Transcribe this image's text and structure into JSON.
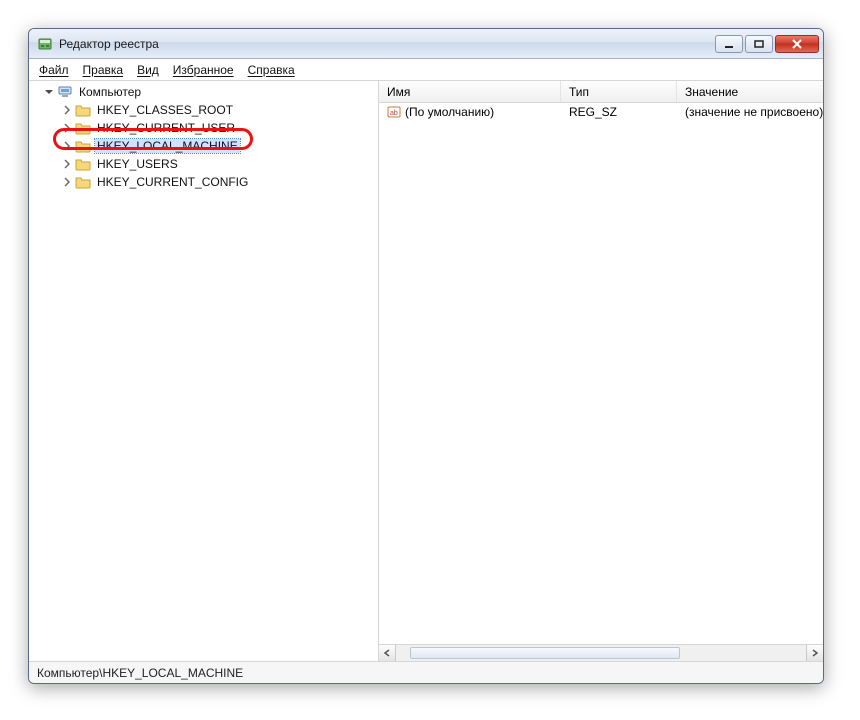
{
  "window": {
    "title": "Редактор реестра"
  },
  "menu": {
    "file": "Файл",
    "edit": "Правка",
    "view": "Вид",
    "favorites": "Избранное",
    "help": "Справка"
  },
  "tree": {
    "root": "Компьютер",
    "items": [
      {
        "label": "HKEY_CLASSES_ROOT"
      },
      {
        "label": "HKEY_CURRENT_USER"
      },
      {
        "label": "HKEY_LOCAL_MACHINE",
        "selected": true,
        "highlighted": true
      },
      {
        "label": "HKEY_USERS"
      },
      {
        "label": "HKEY_CURRENT_CONFIG"
      }
    ]
  },
  "columns": {
    "name": "Имя",
    "type": "Тип",
    "value": "Значение"
  },
  "list": {
    "rows": [
      {
        "name": "(По умолчанию)",
        "type": "REG_SZ",
        "value": "(значение не присвоено)"
      }
    ]
  },
  "statusbar": {
    "path": "Компьютер\\HKEY_LOCAL_MACHINE"
  }
}
